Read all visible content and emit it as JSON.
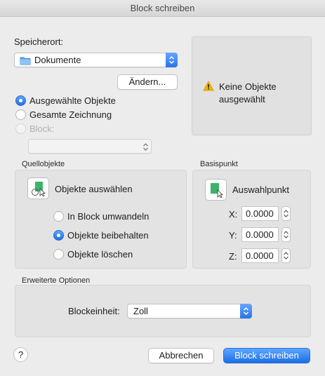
{
  "window": {
    "title": "Block schreiben"
  },
  "save_location": {
    "label": "Speicherort:",
    "selected": "Dokumente",
    "change_button": "Ändern..."
  },
  "source_mode": {
    "options": [
      "Ausgewählte Objekte",
      "Gesamte Zeichnung",
      "Block:"
    ],
    "selected_index": 0,
    "block_dropdown_value": ""
  },
  "preview": {
    "message": "Keine Objekte ausgewählt",
    "icon": "warning-icon"
  },
  "source_objects": {
    "title": "Quellobjekte",
    "select_button": "Objekte auswählen",
    "options": [
      "In Block umwandeln",
      "Objekte beibehalten",
      "Objekte löschen"
    ],
    "selected_index": 1
  },
  "base_point": {
    "title": "Basispunkt",
    "pick_button": "Auswahlpunkt",
    "x_label": "X:",
    "x": "0.0000",
    "y_label": "Y:",
    "y": "0.0000",
    "z_label": "Z:",
    "z": "0.0000"
  },
  "advanced": {
    "title": "Erweiterte Optionen",
    "unit_label": "Blockeinheit:",
    "unit_value": "Zoll"
  },
  "footer": {
    "help": "?",
    "cancel": "Abbrechen",
    "write": "Block schreiben"
  },
  "colors": {
    "accent": "#2a73e8",
    "select_icon_green": "#3db369",
    "warning": "#f4b400"
  }
}
